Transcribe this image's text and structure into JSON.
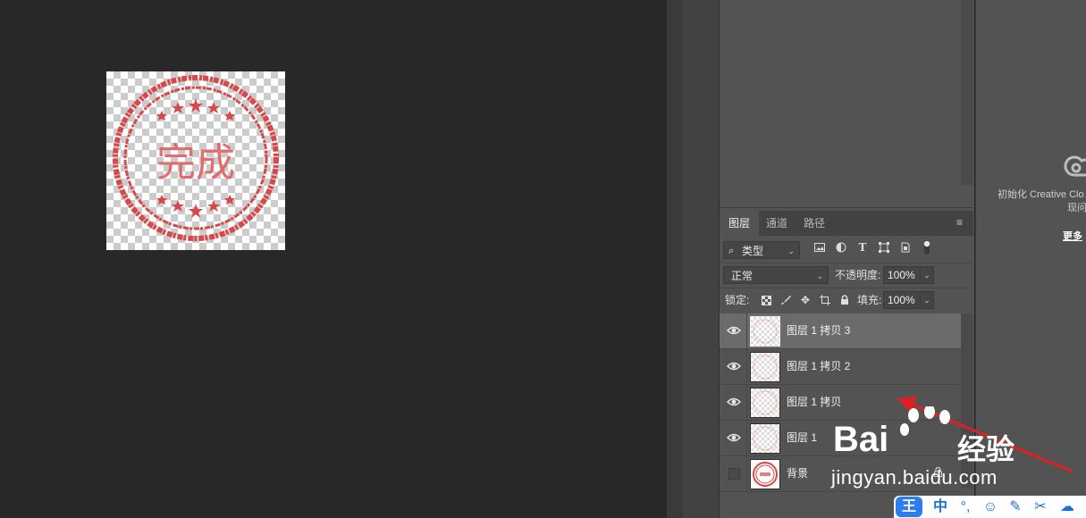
{
  "canvas": {
    "stamp_text": "完成"
  },
  "layers_panel": {
    "tabs": [
      "图层",
      "通道",
      "路径"
    ],
    "menu_icon": "panel-menu-icon",
    "filter": {
      "kind_label": "类型",
      "search_icon": "search-icon"
    },
    "filter_icons": [
      "image-filter-icon",
      "adjustment-filter-icon",
      "type-filter-icon",
      "shape-filter-icon",
      "smart-object-filter-icon",
      "filter-toggle-icon"
    ],
    "blend_mode": "正常",
    "opacity_label": "不透明度:",
    "opacity_value": "100%",
    "lock_label": "锁定:",
    "lock_icons": [
      "lock-transparent-icon",
      "lock-image-icon",
      "lock-position-icon",
      "lock-artboard-icon",
      "lock-all-icon"
    ],
    "fill_label": "填充:",
    "fill_value": "100%",
    "layers": [
      {
        "name": "图层 1 拷贝 3",
        "visible": true,
        "selected": true
      },
      {
        "name": "图层 1 拷贝 2",
        "visible": true,
        "selected": false
      },
      {
        "name": "图层 1 拷贝",
        "visible": true,
        "selected": false
      },
      {
        "name": "图层 1",
        "visible": true,
        "selected": false
      },
      {
        "name": "背景",
        "visible": false,
        "selected": false,
        "locked": true
      }
    ]
  },
  "cc_panel": {
    "line1": "初始化 Creative Clo",
    "line2": "现问",
    "more_link": "更多"
  },
  "watermark": {
    "brand": "Bai",
    "brand2": "经验",
    "url": "jingyan.baidu.com"
  },
  "ime_bar": {
    "logo": "王",
    "items": [
      "中",
      "°,",
      "☺",
      "✎",
      "✂",
      "☁"
    ]
  },
  "colors": {
    "stamp_red": "#d94848",
    "panel_bg": "#535353",
    "canvas_bg": "#282828",
    "selected_layer": "#6b6b6b",
    "arrow_red": "#e02020"
  }
}
